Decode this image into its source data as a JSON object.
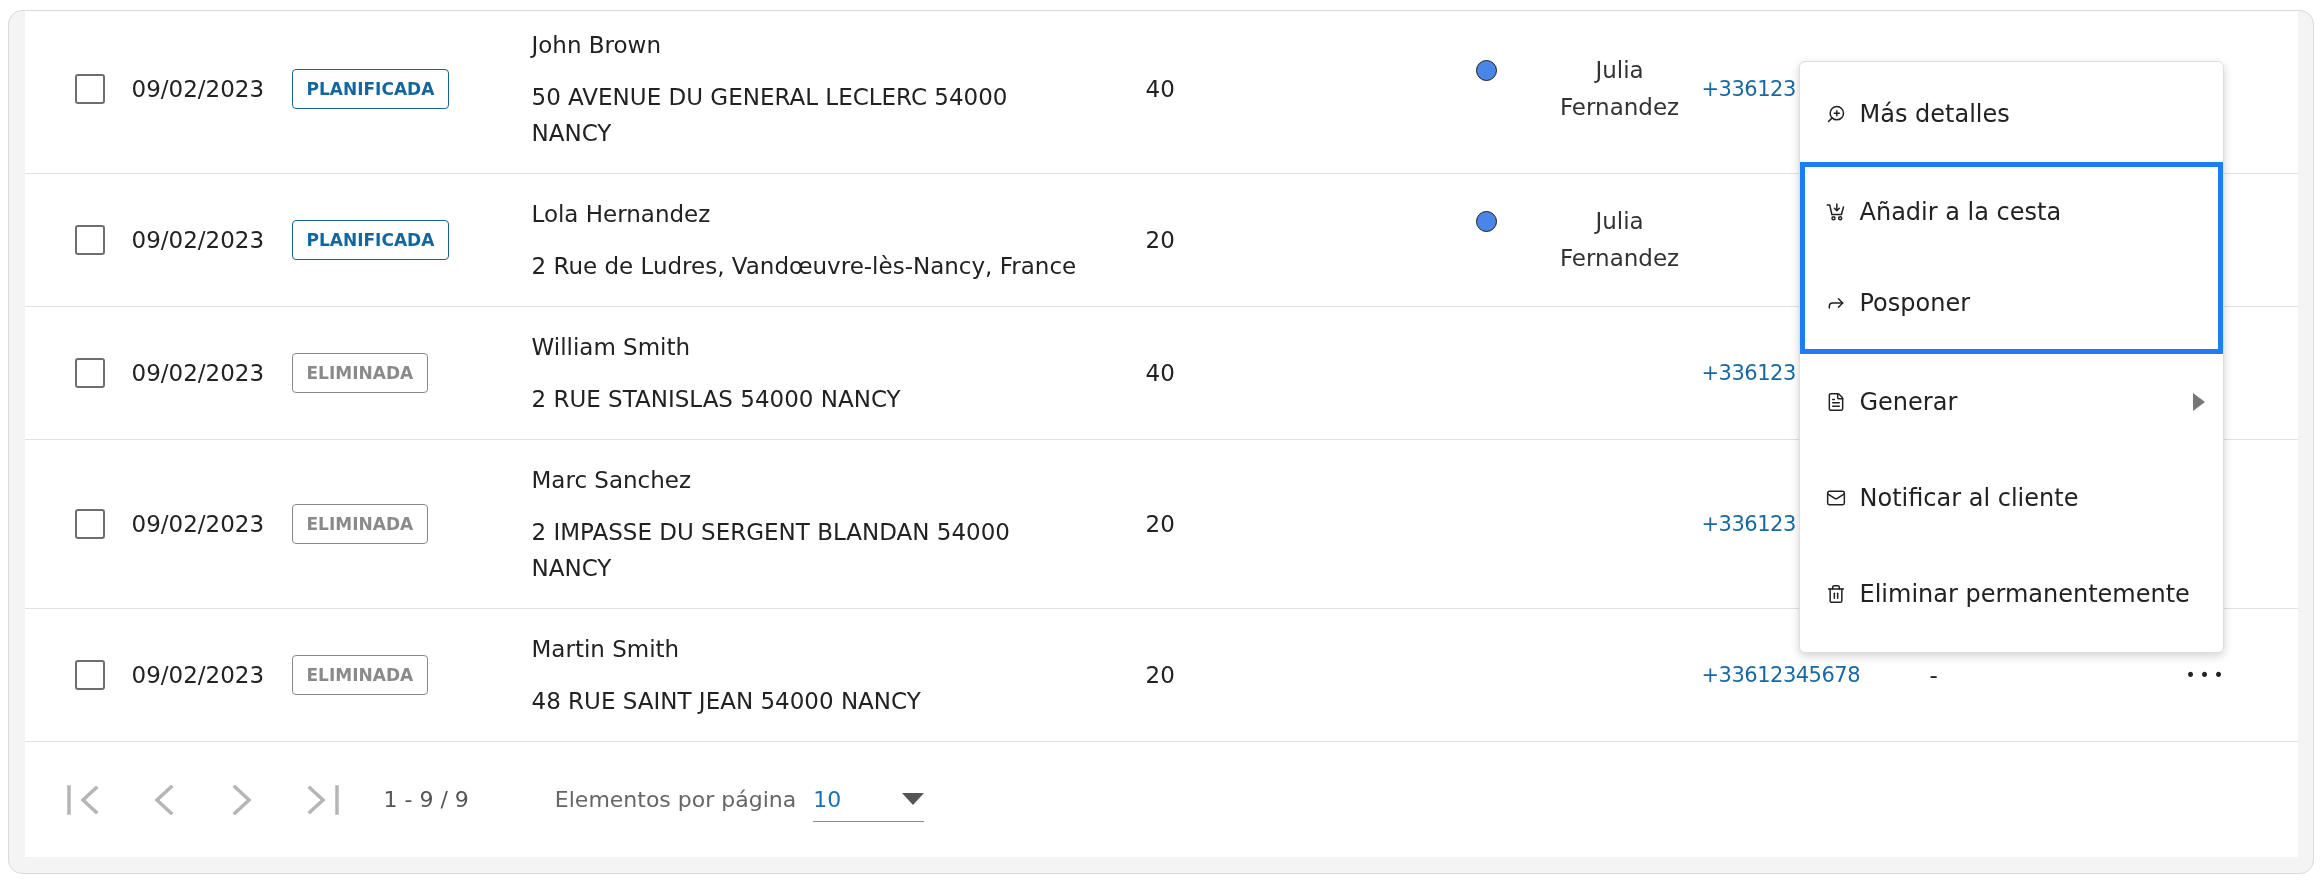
{
  "table": {
    "rows": [
      {
        "checked": false,
        "date": "09/02/2023",
        "status": {
          "label": "PLANIFICADA",
          "kind": "planned"
        },
        "name": "John Brown",
        "address": "50 AVENUE DU GENERAL LECLERC 54000 NANCY",
        "column_5": "40",
        "person": {
          "name": "Julia Fernandez",
          "color": "#4a86e8"
        },
        "phone": "+336123"
      },
      {
        "checked": false,
        "date": "09/02/2023",
        "status": {
          "label": "PLANIFICADA",
          "kind": "planned"
        },
        "name": "Lola Hernandez",
        "address": "2 Rue de Ludres, Vandœuvre-lès-Nancy, France",
        "column_5": "20",
        "person": {
          "name": "Julia Fernandez",
          "color": "#4a86e8"
        }
      },
      {
        "checked": false,
        "date": "09/02/2023",
        "status": {
          "label": "ELIMINADA",
          "kind": "deleted"
        },
        "name": "William Smith",
        "address": "2 RUE STANISLAS 54000 NANCY",
        "column_5": "40",
        "phone": "+336123"
      },
      {
        "checked": false,
        "date": "09/02/2023",
        "status": {
          "label": "ELIMINADA",
          "kind": "deleted"
        },
        "name": "Marc Sanchez",
        "address": "2 IMPASSE DU SERGENT BLANDAN 54000 NANCY",
        "column_5": "20",
        "phone": "+336123"
      },
      {
        "checked": false,
        "date": "09/02/2023",
        "status": {
          "label": "ELIMINADA",
          "kind": "deleted"
        },
        "name": "Martin Smith",
        "address": "48 RUE SAINT JEAN 54000 NANCY",
        "column_5": "20",
        "phone": "+33612345678",
        "column_8": "-",
        "more": "•••"
      }
    ]
  },
  "pagination": {
    "buttons": [
      {
        "kind": "first",
        "disabled": true
      },
      {
        "kind": "previous",
        "disabled": true
      },
      {
        "kind": "next",
        "disabled": true
      },
      {
        "kind": "last",
        "disabled": true
      }
    ],
    "range": "1 - 9 / 9",
    "per_page": {
      "label": "Elementos por página",
      "value": "10"
    }
  },
  "context_menu": {
    "items": [
      {
        "kind": "details",
        "label": "Más detalles",
        "focused": false,
        "submenu": false
      },
      {
        "kind": "basket",
        "label": "Añadir a la cesta",
        "focused": true,
        "submenu": false
      },
      {
        "kind": "postpone",
        "label": "Posponer",
        "focused": true,
        "submenu": false
      },
      {
        "kind": "generate",
        "label": "Generar",
        "focused": false,
        "submenu": true
      },
      {
        "kind": "notify",
        "label": "Notificar al cliente",
        "focused": false,
        "submenu": false
      },
      {
        "kind": "delete",
        "label": "Eliminar permanentemente",
        "focused": false,
        "submenu": false
      }
    ]
  }
}
